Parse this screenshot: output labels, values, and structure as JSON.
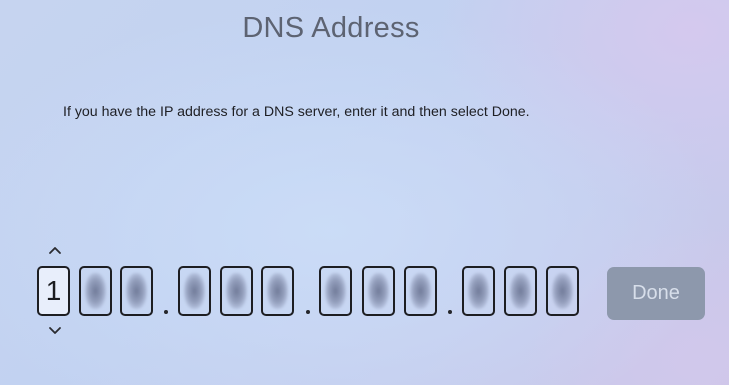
{
  "screen": {
    "title": "DNS Address",
    "instructions": "If you have the IP address for a DNS server, enter it and then select Done."
  },
  "ip_entry": {
    "first_digit": "1",
    "octet_separator": ".",
    "up_icon": "chevron-up-icon",
    "down_icon": "chevron-down-icon"
  },
  "actions": {
    "done_label": "Done"
  },
  "colors": {
    "done_button_bg": "#8d98ac",
    "done_button_text": "#d7deea",
    "title_text": "#5d6372",
    "digit_border": "#1d1e22"
  }
}
